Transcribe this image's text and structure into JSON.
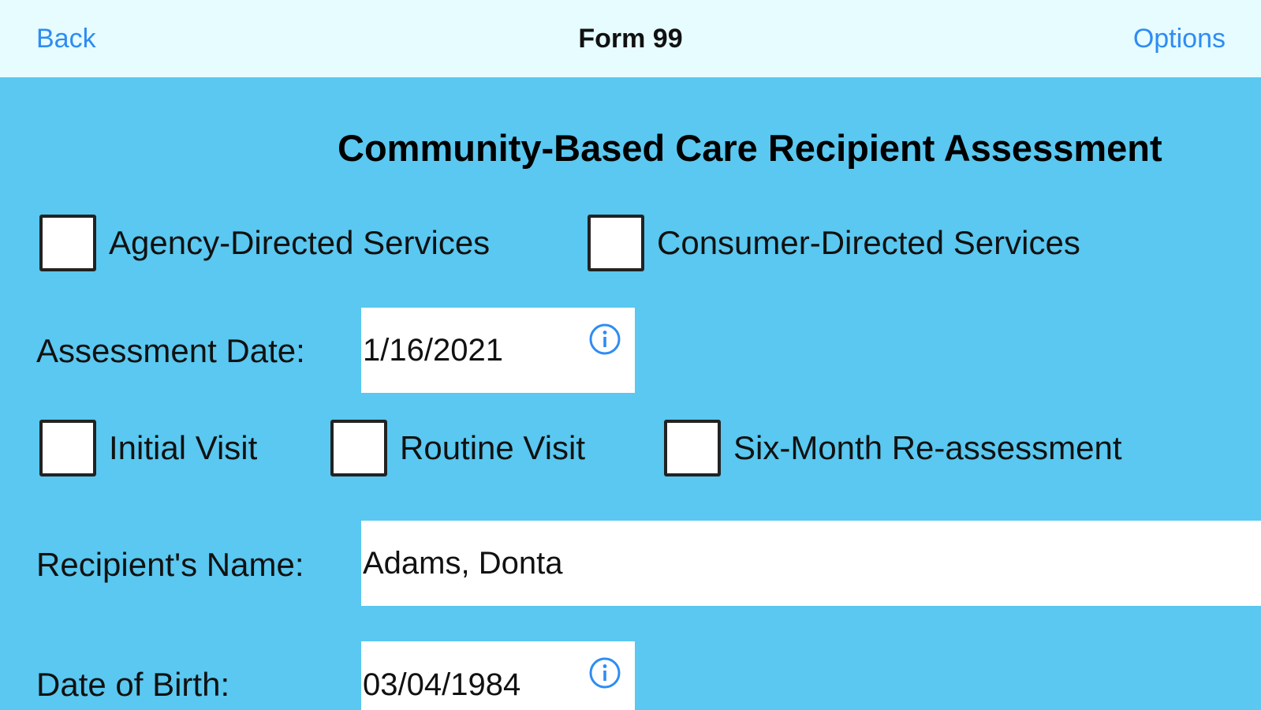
{
  "nav": {
    "back_label": "Back",
    "title": "Form 99",
    "options_label": "Options"
  },
  "form": {
    "title": "Community-Based Care Recipient Assessment",
    "service_types": [
      {
        "label": "Agency-Directed Services",
        "checked": false
      },
      {
        "label": "Consumer-Directed Services",
        "checked": false
      }
    ],
    "assessment_date": {
      "label": "Assessment Date:",
      "value": "1/16/2021",
      "icon": "info-icon"
    },
    "visit_types": [
      {
        "label": "Initial Visit",
        "checked": false
      },
      {
        "label": "Routine Visit",
        "checked": false
      },
      {
        "label": "Six-Month Re-assessment",
        "checked": false
      }
    ],
    "recipient_name": {
      "label": "Recipient's Name:",
      "value": "Adams, Donta"
    },
    "date_of_birth": {
      "label": "Date of Birth:",
      "value": "03/04/1984",
      "icon": "info-icon"
    }
  },
  "colors": {
    "navbar_bg": "#E6FCFF",
    "content_bg": "#5AC8F0",
    "accent": "#2F8CF3"
  }
}
